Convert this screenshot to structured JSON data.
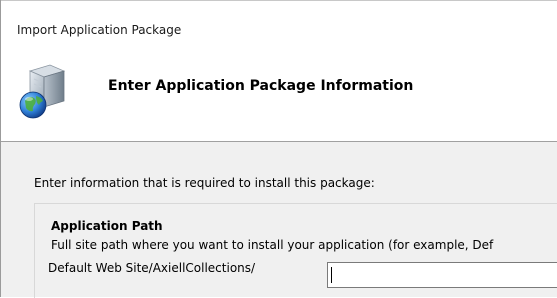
{
  "window": {
    "title": "Import Application Package"
  },
  "header": {
    "title": "Enter Application Package Information",
    "icon": "package-globe-icon"
  },
  "content": {
    "intro": "Enter information that is required to install this package:",
    "group": {
      "label": "Application Path",
      "description": "Full site path where you want to install your application (for example, Def",
      "path_label": "Default Web Site/AxiellCollections/",
      "path_value": ""
    }
  }
}
